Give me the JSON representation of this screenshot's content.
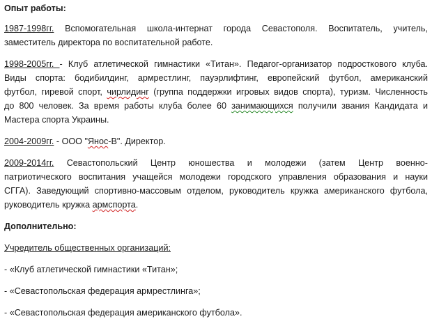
{
  "heading_experience": "Опыт работы:",
  "entries": [
    {
      "dates": "1987-1998гг.",
      "line1": " Вспомогательная школа-интернат города Севастополя. Воспитатель, учитель,",
      "line2": "заместитель директора по воспитательной работе."
    },
    {
      "dates": " 1998-2005гг. ",
      "line1_a": "- Клуб атлетической гимнастики «Титан». Педагог-организатор подросткового клуба.",
      "line2": "Виды спорта: бодибилдинг, армрестлинг, пауэрлифтинг, европейский футбол, американский",
      "line3_a": "футбол, гиревой спорт, ",
      "line3_squig": "чирлидинг",
      "line3_b": " (группа поддержки игровых видов спорта), туризм. Численность",
      "line4_a": "до 800 человек. За время работы клуба более 60 ",
      "line4_squig": "занимающихся",
      "line4_b": " получили звания Кандидата и",
      "line5": "Мастера спорта Украины."
    },
    {
      "dates": "2004-2009гг.",
      "text_a": " - ООО \"",
      "text_squig": "Янос",
      "text_b": "-В\". Директор."
    },
    {
      "dates": "2009-2014гг.",
      "line1": " Севастопольский Центр юношества и молодежи (затем  Центр военно-",
      "line2": "патриотического воспитания учащейся молодежи городского управления образования и науки",
      "line3": "СГГА). Заведующий спортивно-массовым отделом, руководитель кружка американского футбола,",
      "line4_a": "руководитель кружка ",
      "line4_squig": "армспорта",
      "line4_b": "."
    }
  ],
  "heading_additional": "Дополнительно:",
  "founder_label": "Учредитель общественных организаций:",
  "founder_items": [
    " - «Клуб атлетической гимнастики «Титан»;",
    " - «Севастопольская федерация армрестлинга»;",
    " - «Севастопольская федерация американского футбола»."
  ]
}
